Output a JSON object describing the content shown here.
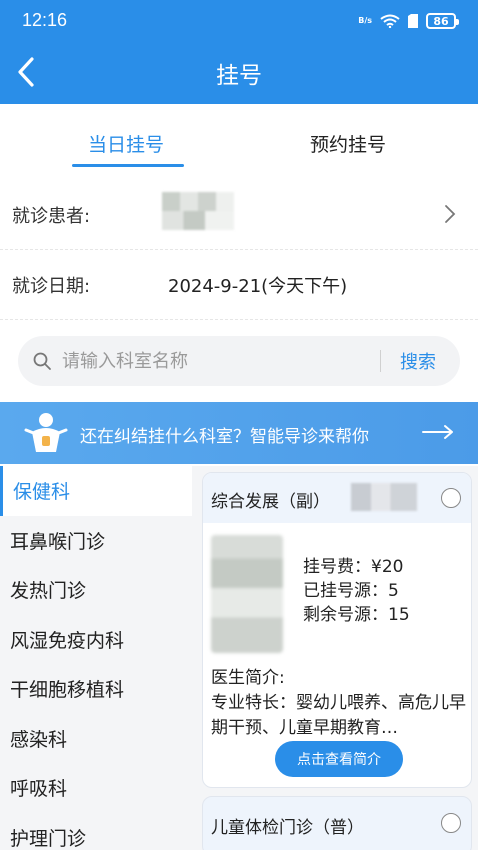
{
  "status": {
    "time": "12:16",
    "net": "B/s",
    "battery": "86"
  },
  "header": {
    "title": "挂号"
  },
  "tabs": [
    {
      "label": "当日挂号"
    },
    {
      "label": "预约挂号"
    }
  ],
  "patient": {
    "label": "就诊患者:"
  },
  "date": {
    "label": "就诊日期:",
    "value": "2024-9-21(今天下午)"
  },
  "search": {
    "placeholder": "请输入科室名称",
    "button": "搜索"
  },
  "banner": {
    "text": "还在纠结挂什么科室？智能导诊来帮你"
  },
  "departments": [
    "保健科",
    "耳鼻喉门诊",
    "发热门诊",
    "风湿免疫内科",
    "干细胞移植科",
    "感染科",
    "呼吸科",
    "护理门诊"
  ],
  "doctors": [
    {
      "name": "综合发展（副）",
      "fee": "挂号费：¥20",
      "booked": "已挂号源：5",
      "remaining": "剩余号源：15",
      "intro_label": "医生简介:",
      "specialty": "专业特长：婴幼儿喂养、高危儿早期干预、儿童早期教育…",
      "intro_button": "点击查看简介"
    },
    {
      "name": "儿童体检门诊（普）"
    }
  ]
}
